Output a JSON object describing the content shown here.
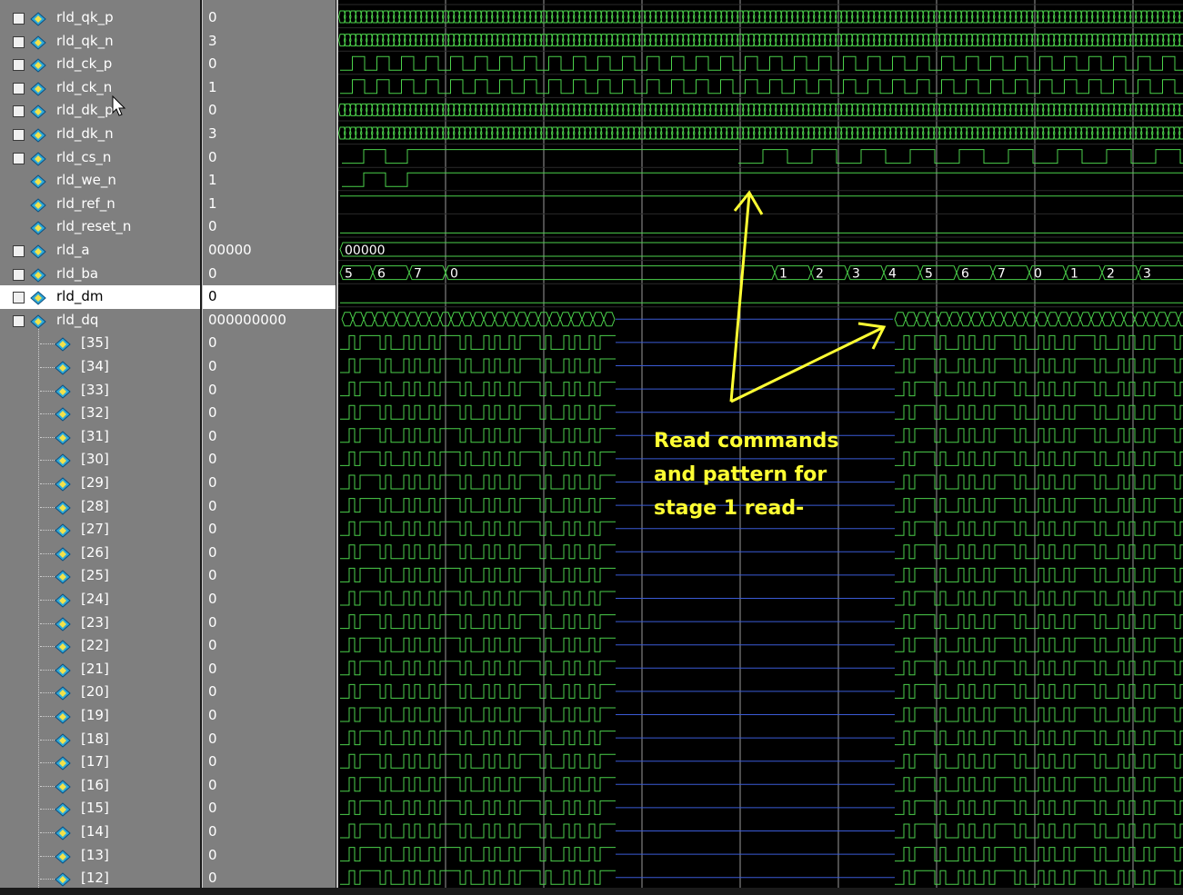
{
  "signals": [
    {
      "name": "rld_qk_p",
      "value": "0",
      "expand": "+",
      "wave": "clkfast"
    },
    {
      "name": "rld_qk_n",
      "value": "3",
      "expand": "+",
      "wave": "clkfast"
    },
    {
      "name": "rld_ck_p",
      "value": "0",
      "expand": "+",
      "wave": "clk"
    },
    {
      "name": "rld_ck_n",
      "value": "1",
      "expand": "+",
      "wave": "clk"
    },
    {
      "name": "rld_dk_p",
      "value": "0",
      "expand": "+",
      "wave": "clkfast"
    },
    {
      "name": "rld_dk_n",
      "value": "3",
      "expand": "+",
      "wave": "clkfast"
    },
    {
      "name": "rld_cs_n",
      "value": "0",
      "expand": "+",
      "wave": "cs"
    },
    {
      "name": "rld_we_n",
      "value": "1",
      "expand": "",
      "wave": "we"
    },
    {
      "name": "rld_ref_n",
      "value": "1",
      "expand": "",
      "wave": "high"
    },
    {
      "name": "rld_reset_n",
      "value": "0",
      "expand": "",
      "wave": "low"
    },
    {
      "name": "rld_a",
      "value": "00000",
      "expand": "+",
      "wave": "bus_a"
    },
    {
      "name": "rld_ba",
      "value": "0",
      "expand": "+",
      "wave": "bus_ba"
    },
    {
      "name": "rld_dm",
      "value": "0",
      "expand": "+",
      "wave": "dm",
      "selected": true
    },
    {
      "name": "rld_dq",
      "value": "000000000",
      "expand": "-",
      "wave": "dqbus"
    },
    {
      "name": "[35]",
      "value": "0",
      "child": true,
      "wave": "dq"
    },
    {
      "name": "[34]",
      "value": "0",
      "child": true,
      "wave": "dq"
    },
    {
      "name": "[33]",
      "value": "0",
      "child": true,
      "wave": "dq"
    },
    {
      "name": "[32]",
      "value": "0",
      "child": true,
      "wave": "dq"
    },
    {
      "name": "[31]",
      "value": "0",
      "child": true,
      "wave": "dq"
    },
    {
      "name": "[30]",
      "value": "0",
      "child": true,
      "wave": "dq"
    },
    {
      "name": "[29]",
      "value": "0",
      "child": true,
      "wave": "dq"
    },
    {
      "name": "[28]",
      "value": "0",
      "child": true,
      "wave": "dq"
    },
    {
      "name": "[27]",
      "value": "0",
      "child": true,
      "wave": "dq"
    },
    {
      "name": "[26]",
      "value": "0",
      "child": true,
      "wave": "dq"
    },
    {
      "name": "[25]",
      "value": "0",
      "child": true,
      "wave": "dq"
    },
    {
      "name": "[24]",
      "value": "0",
      "child": true,
      "wave": "dq"
    },
    {
      "name": "[23]",
      "value": "0",
      "child": true,
      "wave": "dq"
    },
    {
      "name": "[22]",
      "value": "0",
      "child": true,
      "wave": "dq"
    },
    {
      "name": "[21]",
      "value": "0",
      "child": true,
      "wave": "dq"
    },
    {
      "name": "[20]",
      "value": "0",
      "child": true,
      "wave": "dq"
    },
    {
      "name": "[19]",
      "value": "0",
      "child": true,
      "wave": "dq"
    },
    {
      "name": "[18]",
      "value": "0",
      "child": true,
      "wave": "dq"
    },
    {
      "name": "[17]",
      "value": "0",
      "child": true,
      "wave": "dq"
    },
    {
      "name": "[16]",
      "value": "0",
      "child": true,
      "wave": "dq"
    },
    {
      "name": "[15]",
      "value": "0",
      "child": true,
      "wave": "dq"
    },
    {
      "name": "[14]",
      "value": "0",
      "child": true,
      "wave": "dq"
    },
    {
      "name": "[13]",
      "value": "0",
      "child": true,
      "wave": "dq"
    },
    {
      "name": "[12]",
      "value": "0",
      "child": true,
      "wave": "dq"
    }
  ],
  "bus_labels": {
    "rld_a": [
      "00000"
    ],
    "rld_ba": [
      "5",
      "6",
      "7",
      "0",
      "1",
      "2",
      "3",
      "4",
      "5",
      "6",
      "7",
      "0",
      "1",
      "2",
      "3"
    ]
  },
  "annotation": {
    "lines": [
      "Read commands",
      "and pattern for",
      "stage 1 read-"
    ],
    "color": "#ffff33"
  },
  "colors": {
    "wave": "#4bd14b",
    "idle_bus": "#3b5bd6",
    "grid": "#9a9a9a",
    "panel": "#7f7f7f",
    "icon": "#2fa8d8"
  },
  "cursor_icon": "mouse-pointer-icon",
  "row_icon": "signal-diamond-icon"
}
